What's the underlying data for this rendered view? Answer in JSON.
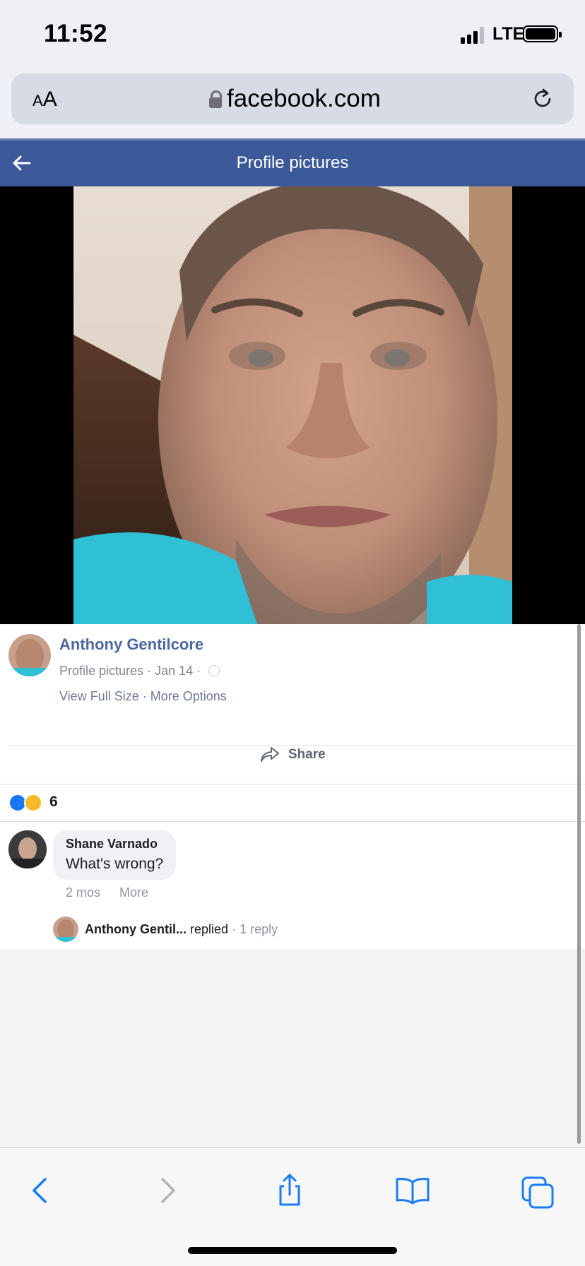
{
  "status_bar": {
    "time": "11:52",
    "network": "LTE"
  },
  "browser": {
    "text_size_label_small": "A",
    "text_size_label_large": "A",
    "domain": "facebook.com"
  },
  "header": {
    "title": "Profile pictures",
    "color": "#3b5998"
  },
  "post": {
    "author": "Anthony Gentilcore",
    "album": "Profile pictures",
    "separator": " · ",
    "date": "Jan 14",
    "view_full_size": "View Full Size",
    "more_options": "More Options",
    "share_label": "Share",
    "reaction_count": "6",
    "reactions": [
      "like",
      "care"
    ]
  },
  "comments": [
    {
      "author": "Shane Varnado",
      "text": "What's wrong?",
      "age": "2 mos",
      "more": "More",
      "reply": {
        "author": "Anthony Gentil...",
        "action": "replied",
        "count": "· 1 reply"
      }
    }
  ],
  "icons": {
    "back": "arrow-left-icon",
    "reload": "reload-icon",
    "lock": "lock-icon",
    "share": "share-arrow-icon",
    "safari_back": "chevron-left-icon",
    "safari_forward": "chevron-right-icon",
    "safari_share": "share-box-icon",
    "bookmarks": "book-icon",
    "tabs": "tabs-icon"
  }
}
